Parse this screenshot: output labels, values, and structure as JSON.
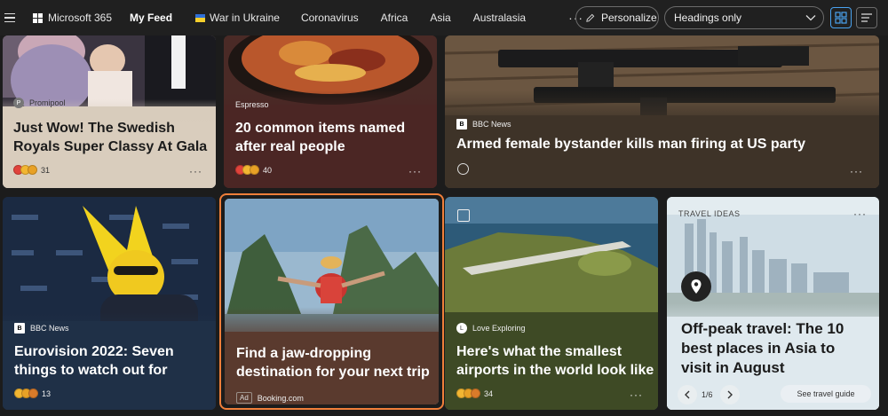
{
  "topbar": {
    "brand": "Microsoft 365",
    "nav": [
      "My Feed",
      "War in Ukraine",
      "Coronavirus",
      "Africa",
      "Asia",
      "Australasia"
    ],
    "more": "···",
    "personalize": "Personalize",
    "view_select": "Headings only"
  },
  "cards": {
    "c1": {
      "source": "Promipool",
      "title": "Just Wow! The Swedish Royals Super Classy At Gala",
      "reactions": "31"
    },
    "c2": {
      "source": "Espresso",
      "title": "20 common items named after real people",
      "reactions": "40"
    },
    "c3": {
      "source": "BBC News",
      "title": "Armed female bystander kills man firing at US party"
    },
    "c4": {
      "source": "BBC News",
      "title": "Eurovision 2022: Seven things to watch out for",
      "reactions": "13"
    },
    "c5": {
      "title": "Find a jaw-dropping destination for your next trip",
      "ad_label": "Ad",
      "advertiser": "Booking.com"
    },
    "c6": {
      "source": "Love Exploring",
      "title": "Here's what the smallest airports in the world look like",
      "reactions": "34"
    },
    "c7": {
      "category": "TRAVEL IDEAS",
      "title": "Off-peak travel: The 10 best places in Asia to visit in August",
      "pager": "1/6",
      "cta": "See travel guide"
    }
  },
  "more_label": "···",
  "colors": {
    "accent": "#4aa3f0",
    "ad_border": "#f07f3a",
    "topbar": "#202020"
  }
}
